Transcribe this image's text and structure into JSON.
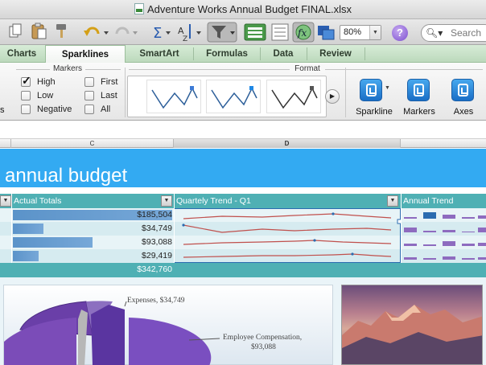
{
  "window": {
    "title": "Adventure Works Annual Budget FINAL.xlsx"
  },
  "toolbar": {
    "zoom": "80%",
    "search_placeholder": "Search",
    "help": "?"
  },
  "ribbon_tabs": [
    "Charts",
    "Sparklines",
    "SmartArt",
    "Formulas",
    "Data",
    "Review"
  ],
  "active_tab": "Sparklines",
  "markers": {
    "title": "Markers",
    "options": [
      {
        "label": "High",
        "checked": true
      },
      {
        "label": "First",
        "checked": false
      },
      {
        "label": "Low",
        "checked": false
      },
      {
        "label": "Last",
        "checked": false
      },
      {
        "label": "Negative",
        "checked": false
      },
      {
        "label": "All",
        "checked": false
      }
    ]
  },
  "format": {
    "title": "Format"
  },
  "ribbon_buttons": [
    "Sparkline",
    "Markers",
    "Axes"
  ],
  "ribbon_left_fragment": "s",
  "columns": [
    "C",
    "D"
  ],
  "sheet": {
    "banner_title": "annual budget",
    "headers": [
      "Actual Totals",
      "Quartely Trend - Q1",
      "Annual Trend"
    ],
    "rows": [
      {
        "value": "$185,504",
        "fraction": 1.0
      },
      {
        "value": "$34,749",
        "fraction": 0.19
      },
      {
        "value": "$93,088",
        "fraction": 0.5
      },
      {
        "value": "$29,419",
        "fraction": 0.16
      }
    ],
    "total": "$342,760"
  },
  "chart_annotations": {
    "expenses": "Expenses, $34,749",
    "employee_line1": "Employee Compensation,",
    "employee_line2": "$93,088"
  },
  "colors": {
    "banner": "#33aaf2",
    "header": "#4fb0b4",
    "bar": "#5b93c9",
    "sparkline": "#c0504d",
    "ribbon_green": "#bcd9bc"
  }
}
